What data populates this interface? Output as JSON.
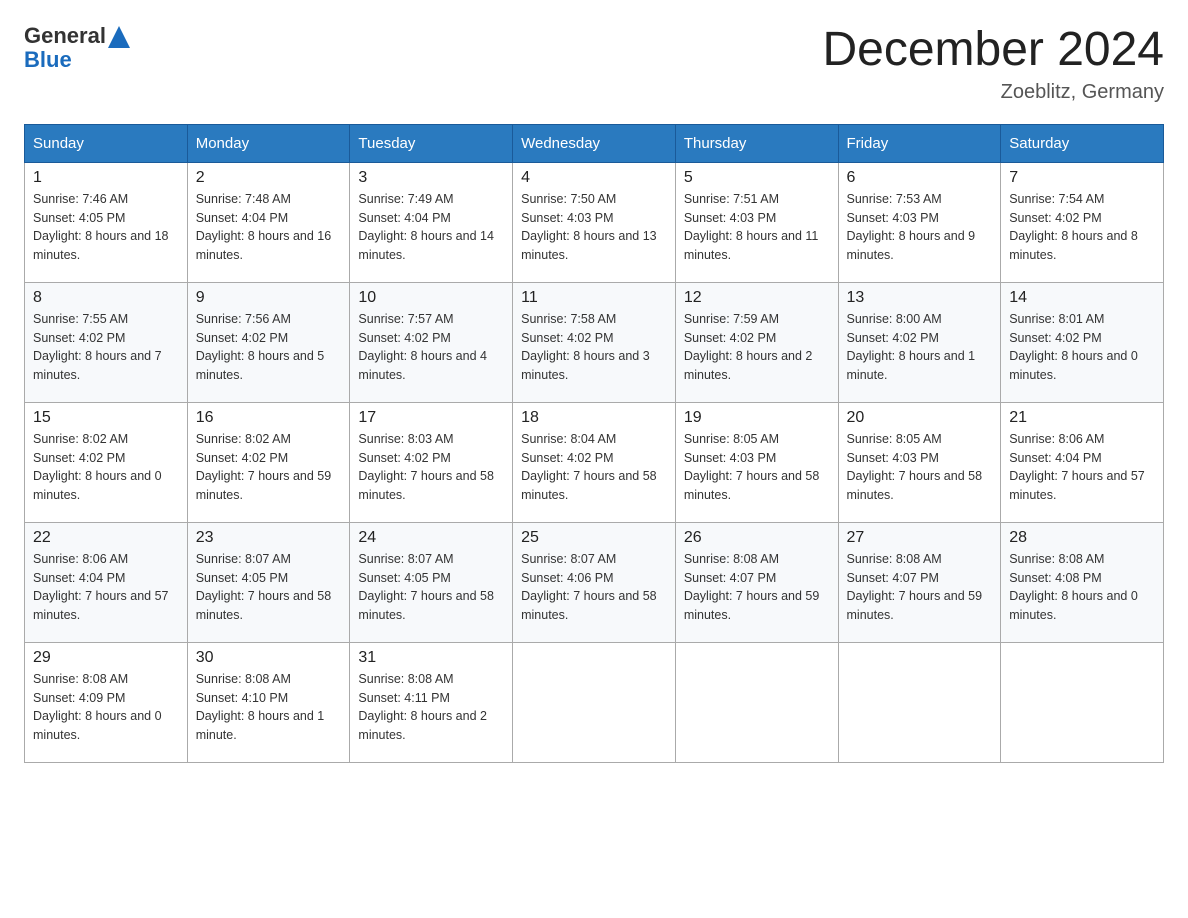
{
  "header": {
    "logo_general": "General",
    "logo_blue": "Blue",
    "title": "December 2024",
    "subtitle": "Zoeblitz, Germany"
  },
  "weekdays": [
    "Sunday",
    "Monday",
    "Tuesday",
    "Wednesday",
    "Thursday",
    "Friday",
    "Saturday"
  ],
  "weeks": [
    [
      {
        "day": "1",
        "sunrise": "7:46 AM",
        "sunset": "4:05 PM",
        "daylight": "8 hours and 18 minutes."
      },
      {
        "day": "2",
        "sunrise": "7:48 AM",
        "sunset": "4:04 PM",
        "daylight": "8 hours and 16 minutes."
      },
      {
        "day": "3",
        "sunrise": "7:49 AM",
        "sunset": "4:04 PM",
        "daylight": "8 hours and 14 minutes."
      },
      {
        "day": "4",
        "sunrise": "7:50 AM",
        "sunset": "4:03 PM",
        "daylight": "8 hours and 13 minutes."
      },
      {
        "day": "5",
        "sunrise": "7:51 AM",
        "sunset": "4:03 PM",
        "daylight": "8 hours and 11 minutes."
      },
      {
        "day": "6",
        "sunrise": "7:53 AM",
        "sunset": "4:03 PM",
        "daylight": "8 hours and 9 minutes."
      },
      {
        "day": "7",
        "sunrise": "7:54 AM",
        "sunset": "4:02 PM",
        "daylight": "8 hours and 8 minutes."
      }
    ],
    [
      {
        "day": "8",
        "sunrise": "7:55 AM",
        "sunset": "4:02 PM",
        "daylight": "8 hours and 7 minutes."
      },
      {
        "day": "9",
        "sunrise": "7:56 AM",
        "sunset": "4:02 PM",
        "daylight": "8 hours and 5 minutes."
      },
      {
        "day": "10",
        "sunrise": "7:57 AM",
        "sunset": "4:02 PM",
        "daylight": "8 hours and 4 minutes."
      },
      {
        "day": "11",
        "sunrise": "7:58 AM",
        "sunset": "4:02 PM",
        "daylight": "8 hours and 3 minutes."
      },
      {
        "day": "12",
        "sunrise": "7:59 AM",
        "sunset": "4:02 PM",
        "daylight": "8 hours and 2 minutes."
      },
      {
        "day": "13",
        "sunrise": "8:00 AM",
        "sunset": "4:02 PM",
        "daylight": "8 hours and 1 minute."
      },
      {
        "day": "14",
        "sunrise": "8:01 AM",
        "sunset": "4:02 PM",
        "daylight": "8 hours and 0 minutes."
      }
    ],
    [
      {
        "day": "15",
        "sunrise": "8:02 AM",
        "sunset": "4:02 PM",
        "daylight": "8 hours and 0 minutes."
      },
      {
        "day": "16",
        "sunrise": "8:02 AM",
        "sunset": "4:02 PM",
        "daylight": "7 hours and 59 minutes."
      },
      {
        "day": "17",
        "sunrise": "8:03 AM",
        "sunset": "4:02 PM",
        "daylight": "7 hours and 58 minutes."
      },
      {
        "day": "18",
        "sunrise": "8:04 AM",
        "sunset": "4:02 PM",
        "daylight": "7 hours and 58 minutes."
      },
      {
        "day": "19",
        "sunrise": "8:05 AM",
        "sunset": "4:03 PM",
        "daylight": "7 hours and 58 minutes."
      },
      {
        "day": "20",
        "sunrise": "8:05 AM",
        "sunset": "4:03 PM",
        "daylight": "7 hours and 58 minutes."
      },
      {
        "day": "21",
        "sunrise": "8:06 AM",
        "sunset": "4:04 PM",
        "daylight": "7 hours and 57 minutes."
      }
    ],
    [
      {
        "day": "22",
        "sunrise": "8:06 AM",
        "sunset": "4:04 PM",
        "daylight": "7 hours and 57 minutes."
      },
      {
        "day": "23",
        "sunrise": "8:07 AM",
        "sunset": "4:05 PM",
        "daylight": "7 hours and 58 minutes."
      },
      {
        "day": "24",
        "sunrise": "8:07 AM",
        "sunset": "4:05 PM",
        "daylight": "7 hours and 58 minutes."
      },
      {
        "day": "25",
        "sunrise": "8:07 AM",
        "sunset": "4:06 PM",
        "daylight": "7 hours and 58 minutes."
      },
      {
        "day": "26",
        "sunrise": "8:08 AM",
        "sunset": "4:07 PM",
        "daylight": "7 hours and 59 minutes."
      },
      {
        "day": "27",
        "sunrise": "8:08 AM",
        "sunset": "4:07 PM",
        "daylight": "7 hours and 59 minutes."
      },
      {
        "day": "28",
        "sunrise": "8:08 AM",
        "sunset": "4:08 PM",
        "daylight": "8 hours and 0 minutes."
      }
    ],
    [
      {
        "day": "29",
        "sunrise": "8:08 AM",
        "sunset": "4:09 PM",
        "daylight": "8 hours and 0 minutes."
      },
      {
        "day": "30",
        "sunrise": "8:08 AM",
        "sunset": "4:10 PM",
        "daylight": "8 hours and 1 minute."
      },
      {
        "day": "31",
        "sunrise": "8:08 AM",
        "sunset": "4:11 PM",
        "daylight": "8 hours and 2 minutes."
      },
      null,
      null,
      null,
      null
    ]
  ]
}
